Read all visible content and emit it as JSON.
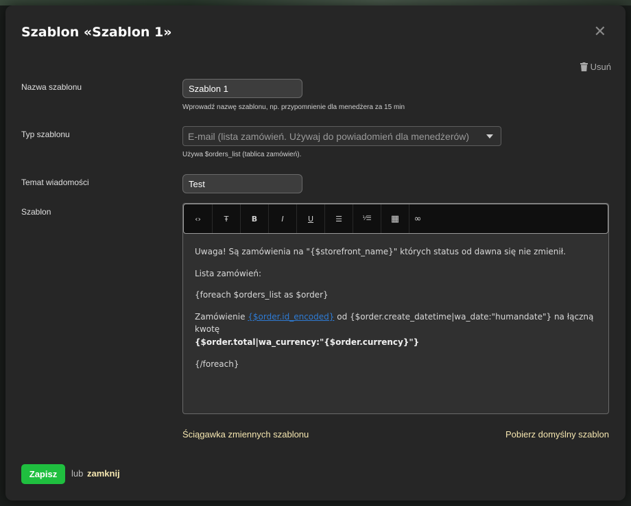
{
  "dialog": {
    "title": "Szablon «Szablon 1»",
    "close_symbol": "✕",
    "delete_label": "Usuń"
  },
  "fields": {
    "name": {
      "label": "Nazwa szablonu",
      "value": "Szablon 1",
      "hint": "Wprowadź nazwę szablonu, np. przypomnienie dla menedżera za 15 min"
    },
    "type": {
      "label": "Typ szablonu",
      "selected": "E-mail (lista zamówień. Używaj do powiadomień dla menedżerów)",
      "hint": "Używa $orders_list (tablica zamówień)."
    },
    "subject": {
      "label": "Temat wiadomości",
      "value": "Test"
    },
    "template": {
      "label": "Szablon"
    }
  },
  "toolbar": {
    "buttons": [
      {
        "name": "code-icon",
        "glyph": "‹›"
      },
      {
        "name": "strikethrough-icon",
        "glyph": "Ŧ"
      },
      {
        "name": "bold-icon",
        "glyph": "B"
      },
      {
        "name": "italic-icon",
        "glyph": "I"
      },
      {
        "name": "underline-icon",
        "glyph": "U"
      },
      {
        "name": "bullet-list-icon",
        "glyph": "☰"
      },
      {
        "name": "numbered-list-icon",
        "glyph": "⅟☰"
      },
      {
        "name": "table-icon",
        "glyph": "▦"
      },
      {
        "name": "link-icon",
        "glyph": "∞"
      }
    ]
  },
  "editor_content": {
    "line1": "Uwaga! Są zamówienia na \"{$storefront_name}\" których status od dawna się nie zmienił.",
    "line2": "Lista zamówień:",
    "line3": "{foreach $orders_list as $order}",
    "line4_prefix": "Zamówienie ",
    "line4_link": "{$order.id_encoded}",
    "line4_middle": " od {$order.create_datetime|wa_date:\"humandate\"} na łączną kwotę",
    "line4_bold": "{$order.total|wa_currency:\"{$order.currency}\"}",
    "line5": "{/foreach}"
  },
  "links": {
    "cheatsheet": "Ściągawka zmiennych szablonu",
    "default_template": "Pobierz domyślny szablon"
  },
  "footer": {
    "save_label": "Zapisz",
    "or_text": "lub",
    "close_label": "zamknij"
  },
  "colors": {
    "save_button": "#1fbf3f",
    "link": "#f5e6b0",
    "inline_link": "#2e7bd4"
  }
}
